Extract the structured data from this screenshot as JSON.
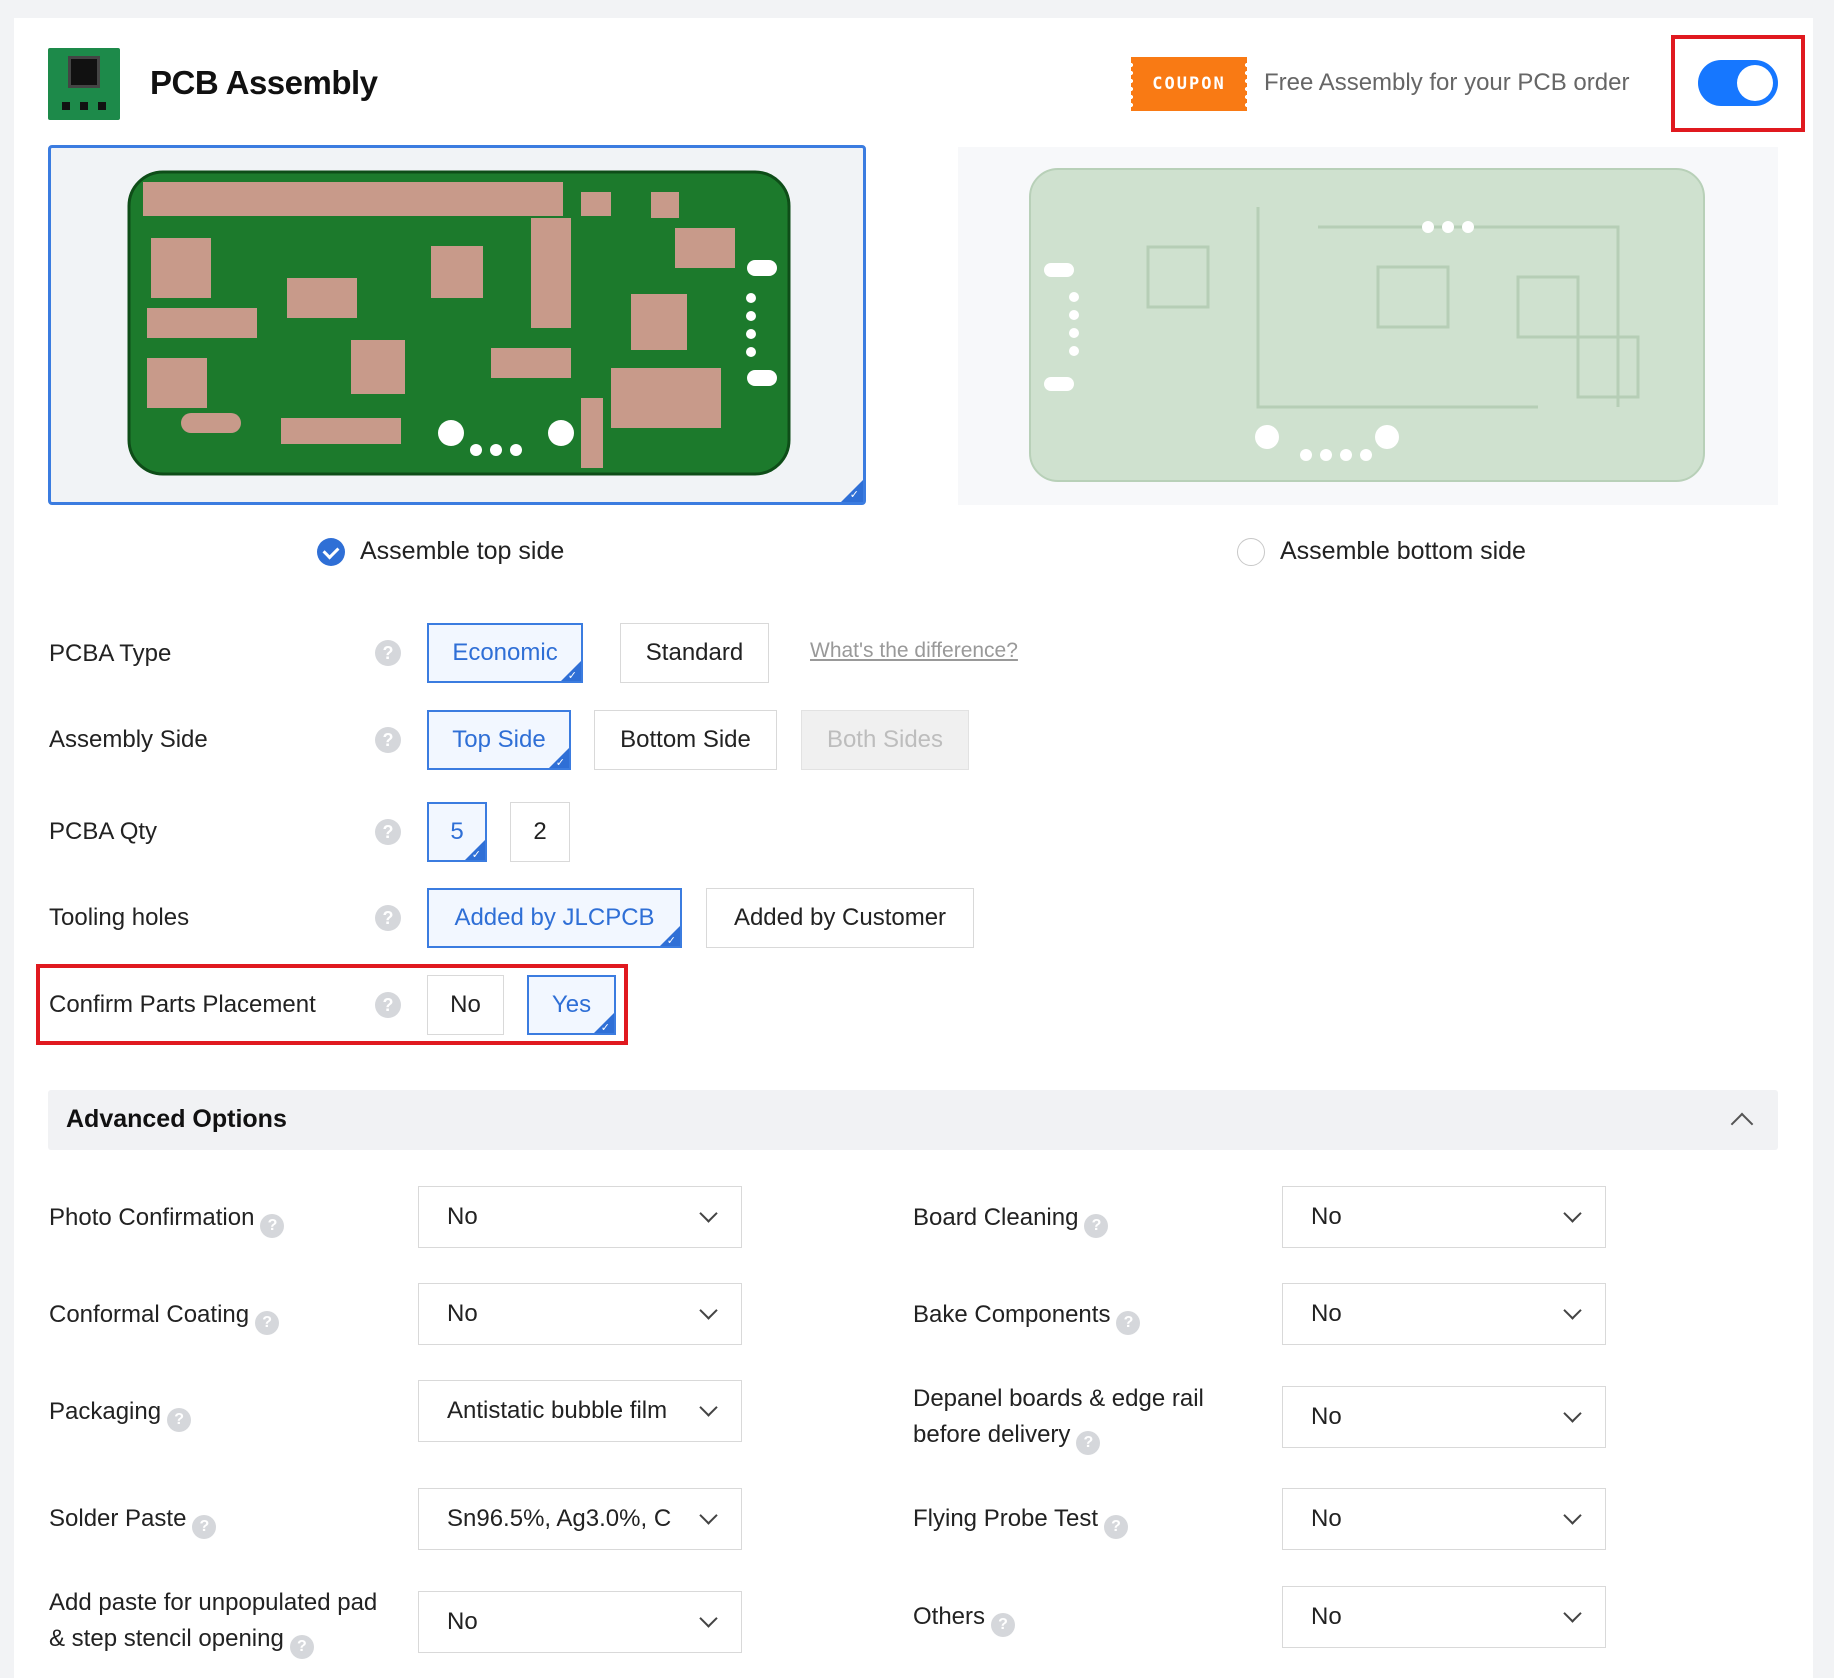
{
  "header": {
    "title": "PCB Assembly",
    "coupon_label": "COUPON",
    "promo_text": "Free Assembly for your PCB order",
    "toggle_on": true,
    "accent_color": "#2f6fd6",
    "highlight_color": "#e0191f"
  },
  "sides": {
    "top_label": "Assemble top side",
    "bottom_label": "Assemble bottom side",
    "top_selected": true
  },
  "options": {
    "pcba_type": {
      "label": "PCBA Type",
      "choices": [
        "Economic",
        "Standard"
      ],
      "selected": "Economic",
      "link": "What's the difference?"
    },
    "assembly_side": {
      "label": "Assembly Side",
      "choices": [
        "Top Side",
        "Bottom Side",
        "Both Sides"
      ],
      "selected": "Top Side",
      "disabled": "Both Sides"
    },
    "pcba_qty": {
      "label": "PCBA Qty",
      "choices": [
        "5",
        "2"
      ],
      "selected": "5"
    },
    "tooling_holes": {
      "label": "Tooling holes",
      "choices": [
        "Added by JLCPCB",
        "Added by Customer"
      ],
      "selected": "Added by JLCPCB"
    },
    "confirm_parts": {
      "label": "Confirm Parts Placement",
      "choices": [
        "No",
        "Yes"
      ],
      "selected": "Yes"
    }
  },
  "advanced": {
    "title": "Advanced Options",
    "left": [
      {
        "label": "Photo Confirmation",
        "value": "No"
      },
      {
        "label": "Conformal Coating",
        "value": "No"
      },
      {
        "label": "Packaging",
        "value": "Antistatic bubble film"
      },
      {
        "label": "Solder Paste",
        "value": "Sn96.5%, Ag3.0%, C"
      },
      {
        "label_line1": "Add paste for unpopulated pad",
        "label_line2": "& step stencil opening",
        "value": "No"
      }
    ],
    "right": [
      {
        "label": "Board Cleaning",
        "value": "No"
      },
      {
        "label": "Bake Components",
        "value": "No"
      },
      {
        "label_line1": "Depanel boards & edge rail",
        "label_line2": "before delivery",
        "value": "No"
      },
      {
        "label": "Flying Probe Test",
        "value": "No"
      },
      {
        "label": "Others",
        "value": "No"
      }
    ]
  },
  "icons": {
    "help": "question-circle-icon",
    "dropdown": "chevron-down-icon",
    "collapse": "chevron-up-icon",
    "selected_mark": "check-icon"
  }
}
